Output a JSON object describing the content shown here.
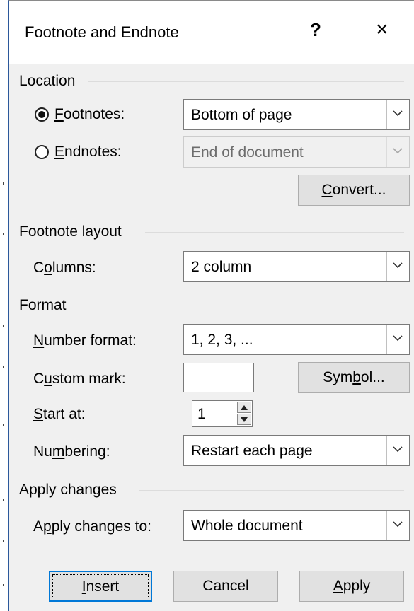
{
  "dialog": {
    "title": "Footnote and Endnote",
    "help_label": "?",
    "close_label": "×"
  },
  "location": {
    "section_label": "Location",
    "footnotes": {
      "label_key": "F",
      "label_rest": "ootnotes:",
      "selected": true,
      "value": "Bottom of page"
    },
    "endnotes": {
      "label_key": "E",
      "label_rest": "ndnotes:",
      "selected": false,
      "value": "End of document"
    },
    "convert_key": "C",
    "convert_rest": "onvert..."
  },
  "layout": {
    "section_label": "Footnote layout",
    "columns_pre": "C",
    "columns_key": "o",
    "columns_rest": "lumns:",
    "columns_value": "2 column"
  },
  "format": {
    "section_label": "Format",
    "number_format_key": "N",
    "number_format_rest": "umber format:",
    "number_format_value": "1, 2, 3, ...",
    "custom_mark_pre": "C",
    "custom_mark_key": "u",
    "custom_mark_rest": "stom mark:",
    "custom_mark_value": "",
    "symbol_pre": "Sym",
    "symbol_key": "b",
    "symbol_rest": "ol...",
    "start_at_key": "S",
    "start_at_rest": "tart at:",
    "start_at_value": "1",
    "numbering_pre": "Nu",
    "numbering_key": "m",
    "numbering_rest": "bering:",
    "numbering_value": "Restart each page"
  },
  "apply": {
    "section_label": "Apply changes",
    "apply_to_pre": "A",
    "apply_to_key": "p",
    "apply_to_rest": "ply changes to:",
    "apply_to_value": "Whole document"
  },
  "buttons": {
    "insert_key": "I",
    "insert_rest": "nsert",
    "cancel": "Cancel",
    "apply_key": "A",
    "apply_rest": "pply"
  }
}
